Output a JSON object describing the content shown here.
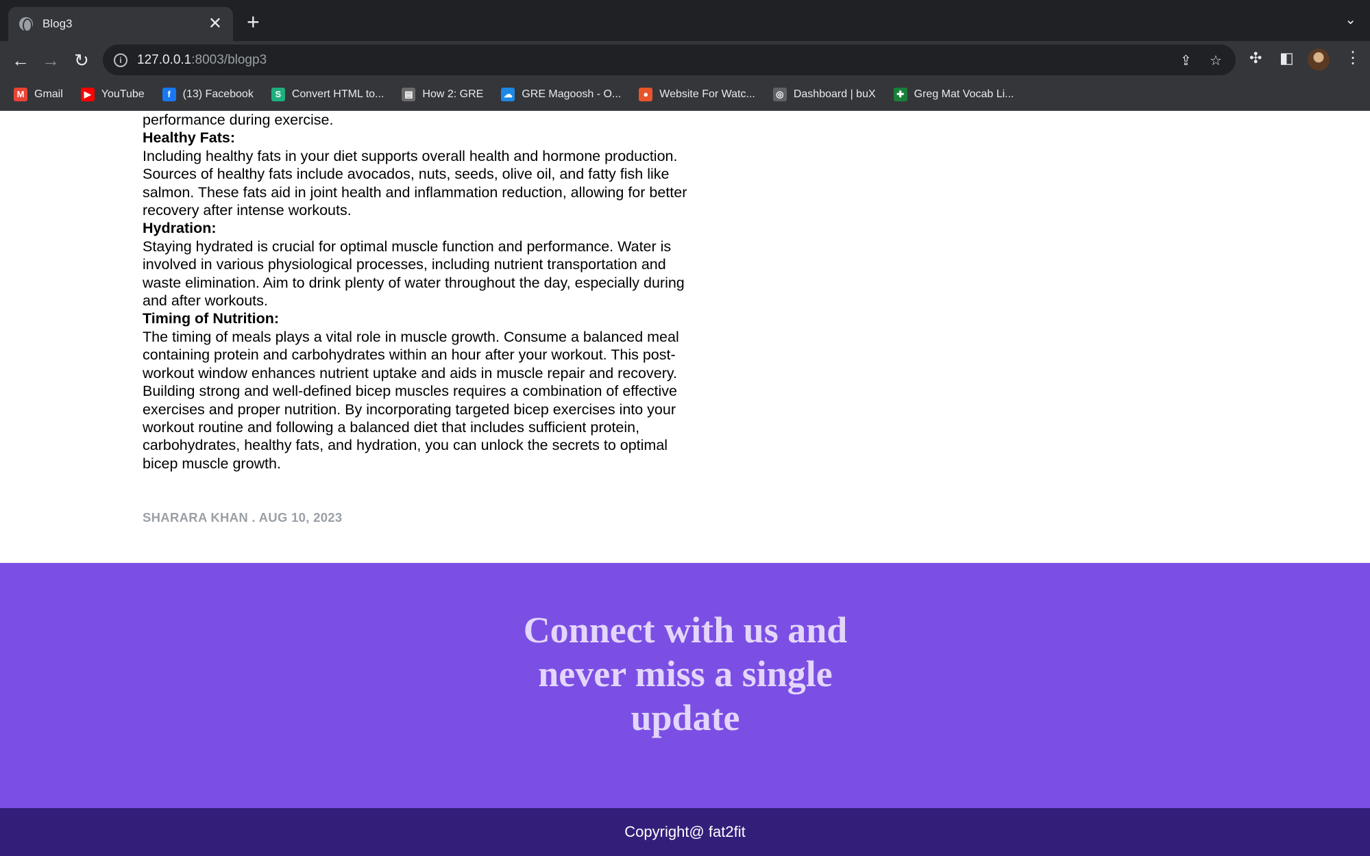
{
  "browser": {
    "tab_title": "Blog3",
    "tab_close": "✕",
    "new_tab": "+",
    "url_host": "127.0.0.1",
    "url_rest": ":8003/blogp3",
    "bookmarks": [
      {
        "label": "Gmail",
        "icon": "gmail-icon",
        "color": "#ea4335",
        "glyph": "M"
      },
      {
        "label": "YouTube",
        "icon": "youtube-icon",
        "color": "#ff0000",
        "glyph": "▶"
      },
      {
        "label": "(13) Facebook",
        "icon": "facebook-icon",
        "color": "#1877f2",
        "glyph": "f"
      },
      {
        "label": "Convert HTML to...",
        "icon": "convert-icon",
        "color": "#1fae7e",
        "glyph": "S"
      },
      {
        "label": "How 2: GRE",
        "icon": "document-icon",
        "color": "#6b6b6b",
        "glyph": "▤"
      },
      {
        "label": "GRE Magoosh - O...",
        "icon": "cloud-icon",
        "color": "#1e88e5",
        "glyph": "☁"
      },
      {
        "label": "Website For Watc...",
        "icon": "website-icon",
        "color": "#e8552b",
        "glyph": "●"
      },
      {
        "label": "Dashboard | buX",
        "icon": "dashboard-icon",
        "color": "#5f6368",
        "glyph": "◎"
      },
      {
        "label": "Greg Mat Vocab Li...",
        "icon": "sheets-icon",
        "color": "#188038",
        "glyph": "✚"
      }
    ]
  },
  "article": {
    "intro_tail": "performance during exercise.",
    "sections": [
      {
        "heading": "Healthy Fats:",
        "body": "Including healthy fats in your diet supports overall health and hormone production. Sources of healthy fats include avocados, nuts, seeds, olive oil, and fatty fish like salmon. These fats aid in joint health and inflammation reduction, allowing for better recovery after intense workouts."
      },
      {
        "heading": "Hydration:",
        "body": "Staying hydrated is crucial for optimal muscle function and performance. Water is involved in various physiological processes, including nutrient transportation and waste elimination. Aim to drink plenty of water throughout the day, especially during and after workouts."
      },
      {
        "heading": "Timing of Nutrition:",
        "body": "The timing of meals plays a vital role in muscle growth. Consume a balanced meal containing protein and carbohydrates within an hour after your workout. This post-workout window enhances nutrient uptake and aids in muscle repair and recovery."
      }
    ],
    "conclusion": "Building strong and well-defined bicep muscles requires a combination of effective exercises and proper nutrition. By incorporating targeted bicep exercises into your workout routine and following a balanced diet that includes sufficient protein, carbohydrates, healthy fats, and hydration, you can unlock the secrets to optimal bicep muscle growth.",
    "meta": "SHARARA KHAN . AUG 10, 2023"
  },
  "cta": {
    "title": "Connect with us and never miss a single update"
  },
  "footer": {
    "copyright": "Copyright@ fat2fit"
  },
  "colors": {
    "cta_bg": "#7b4fe4",
    "cta_text": "#e4d6fb",
    "footer_bg": "#331f7a",
    "meta_text": "#9aa0a6"
  }
}
